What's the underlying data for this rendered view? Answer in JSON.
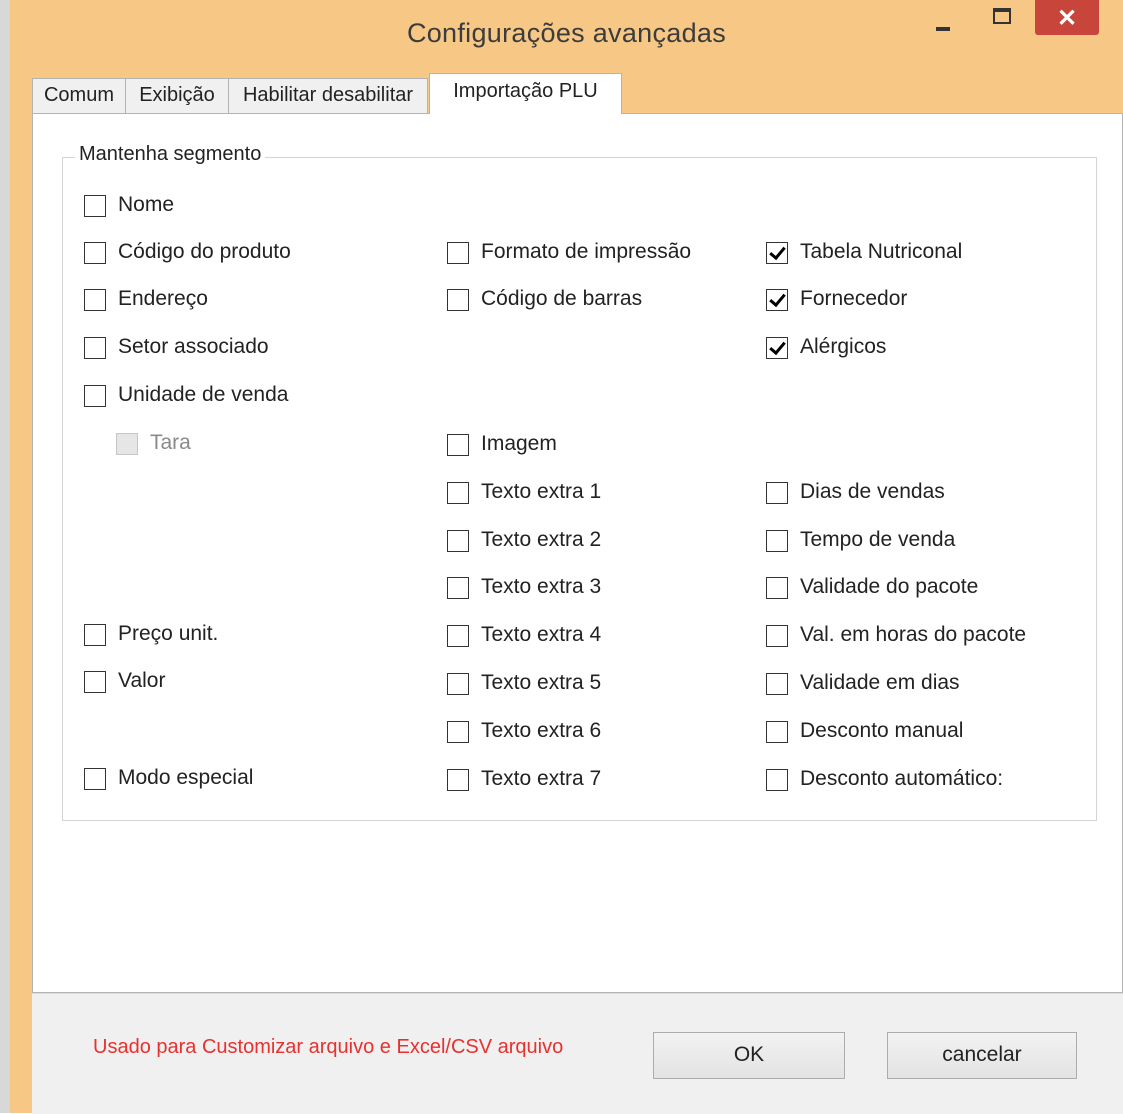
{
  "window": {
    "title": "Configurações avançadas"
  },
  "titlebar_controls": {
    "minimize_icon": "minimize-icon",
    "maximize_icon": "maximize-icon",
    "close_glyph": "✕"
  },
  "tabs": [
    {
      "label": "Comum",
      "active": false
    },
    {
      "label": "Exibição",
      "active": false
    },
    {
      "label": "Habilitar desabilitar",
      "active": false
    },
    {
      "label": "Importação PLU",
      "active": true
    }
  ],
  "group": {
    "legend": "Mantenha segmento"
  },
  "checkboxes": [
    {
      "label": "Nome",
      "checked": false,
      "enabled": true
    },
    {
      "label": "Código do produto",
      "checked": false,
      "enabled": true
    },
    {
      "label": "Endereço",
      "checked": false,
      "enabled": true
    },
    {
      "label": "Setor associado",
      "checked": false,
      "enabled": true
    },
    {
      "label": "Unidade de venda",
      "checked": false,
      "enabled": true
    },
    {
      "label": "Tara",
      "checked": false,
      "enabled": false
    },
    {
      "label": "Preço unit.",
      "checked": false,
      "enabled": true
    },
    {
      "label": "Valor",
      "checked": false,
      "enabled": true
    },
    {
      "label": "Modo especial",
      "checked": false,
      "enabled": true
    },
    {
      "label": "Formato de impressão",
      "checked": false,
      "enabled": true
    },
    {
      "label": "Código de barras",
      "checked": false,
      "enabled": true
    },
    {
      "label": "Imagem",
      "checked": false,
      "enabled": true
    },
    {
      "label": "Texto extra 1",
      "checked": false,
      "enabled": true
    },
    {
      "label": "Texto extra 2",
      "checked": false,
      "enabled": true
    },
    {
      "label": "Texto extra 3",
      "checked": false,
      "enabled": true
    },
    {
      "label": "Texto extra 4",
      "checked": false,
      "enabled": true
    },
    {
      "label": "Texto extra 5",
      "checked": false,
      "enabled": true
    },
    {
      "label": "Texto extra 6",
      "checked": false,
      "enabled": true
    },
    {
      "label": "Texto extra 7",
      "checked": false,
      "enabled": true
    },
    {
      "label": "Tabela Nutriconal",
      "checked": true,
      "enabled": true
    },
    {
      "label": "Fornecedor",
      "checked": true,
      "enabled": true
    },
    {
      "label": "Alérgicos",
      "checked": true,
      "enabled": true
    },
    {
      "label": "Dias de vendas",
      "checked": false,
      "enabled": true
    },
    {
      "label": "Tempo de venda",
      "checked": false,
      "enabled": true
    },
    {
      "label": "Validade do pacote",
      "checked": false,
      "enabled": true
    },
    {
      "label": "Val. em horas do pacote",
      "checked": false,
      "enabled": true
    },
    {
      "label": "Validade em dias",
      "checked": false,
      "enabled": true
    },
    {
      "label": "Desconto manual",
      "checked": false,
      "enabled": true
    },
    {
      "label": "Desconto automático:",
      "checked": false,
      "enabled": true
    }
  ],
  "footer": {
    "note": "Usado para Customizar arquivo e Excel/CSV arquivo",
    "ok_label": "OK",
    "cancel_label": "cancelar"
  },
  "colors": {
    "titlebar": "#f7c785",
    "close": "#c7453a",
    "note": "#e8312f"
  }
}
